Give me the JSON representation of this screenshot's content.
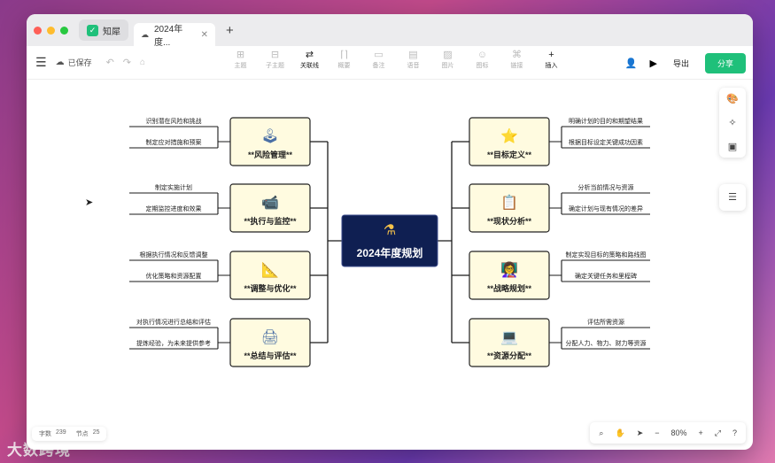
{
  "watermark": "大数跨境",
  "tabs": {
    "app_label": "知犀",
    "doc_label": "2024年度..."
  },
  "toolbar": {
    "saved": "已保存",
    "tools": [
      {
        "icon": "⊞",
        "label": "主题"
      },
      {
        "icon": "⊟",
        "label": "子主题"
      },
      {
        "icon": "⇄",
        "label": "关联线"
      },
      {
        "icon": "⌈⌉",
        "label": "概要"
      },
      {
        "icon": "▭",
        "label": "备注"
      },
      {
        "icon": "▤",
        "label": "语音"
      },
      {
        "icon": "▨",
        "label": "图片"
      },
      {
        "icon": "☺",
        "label": "图标"
      },
      {
        "icon": "⌘",
        "label": "链接"
      },
      {
        "icon": "+",
        "label": "插入"
      }
    ],
    "export_label": "导出",
    "share_label": "分享"
  },
  "colors": {
    "accent": "#1fc07a",
    "root_bg": "#0f1f52",
    "node_bg": "#fffbe0",
    "line": "#1a1a1a"
  },
  "mindmap": {
    "root": "2024年度规划",
    "left": [
      {
        "label": "**风险管理**",
        "icon": "joystick-icon",
        "leaves": [
          "识别潜在风险和挑战",
          "制定应对措施和预案"
        ]
      },
      {
        "label": "**执行与监控**",
        "icon": "camera-icon",
        "leaves": [
          "制定实施计划",
          "定期监控进度和效果"
        ]
      },
      {
        "label": "**调整与优化**",
        "icon": "ruler-icon",
        "leaves": [
          "根据执行情况和反馈调整",
          "优化策略和资源配置"
        ]
      },
      {
        "label": "**总结与评估**",
        "icon": "printer-icon",
        "leaves": [
          "对执行情况进行总结和评估",
          "提炼经验，为未来提供参考"
        ]
      }
    ],
    "right": [
      {
        "label": "**目标定义**",
        "icon": "star-badge-icon",
        "leaves": [
          "明确计划的目的和期望结果",
          "根据目标设定关键成功因素"
        ]
      },
      {
        "label": "**现状分析**",
        "icon": "clipboard-icon",
        "leaves": [
          "分析当前情况与资源",
          "确定计划与现有情况的差异"
        ]
      },
      {
        "label": "**战略规划**",
        "icon": "teacher-icon",
        "leaves": [
          "制定实现目标的策略和路线图",
          "确定关键任务和里程碑"
        ]
      },
      {
        "label": "**资源分配**",
        "icon": "laptop-icon",
        "leaves": [
          "评估所需资源",
          "分配人力、物力、财力等资源"
        ]
      }
    ]
  },
  "stats": {
    "words_label": "字数",
    "words": "239",
    "nodes_label": "节点",
    "nodes": "25"
  },
  "zoom": {
    "level": "80%"
  }
}
